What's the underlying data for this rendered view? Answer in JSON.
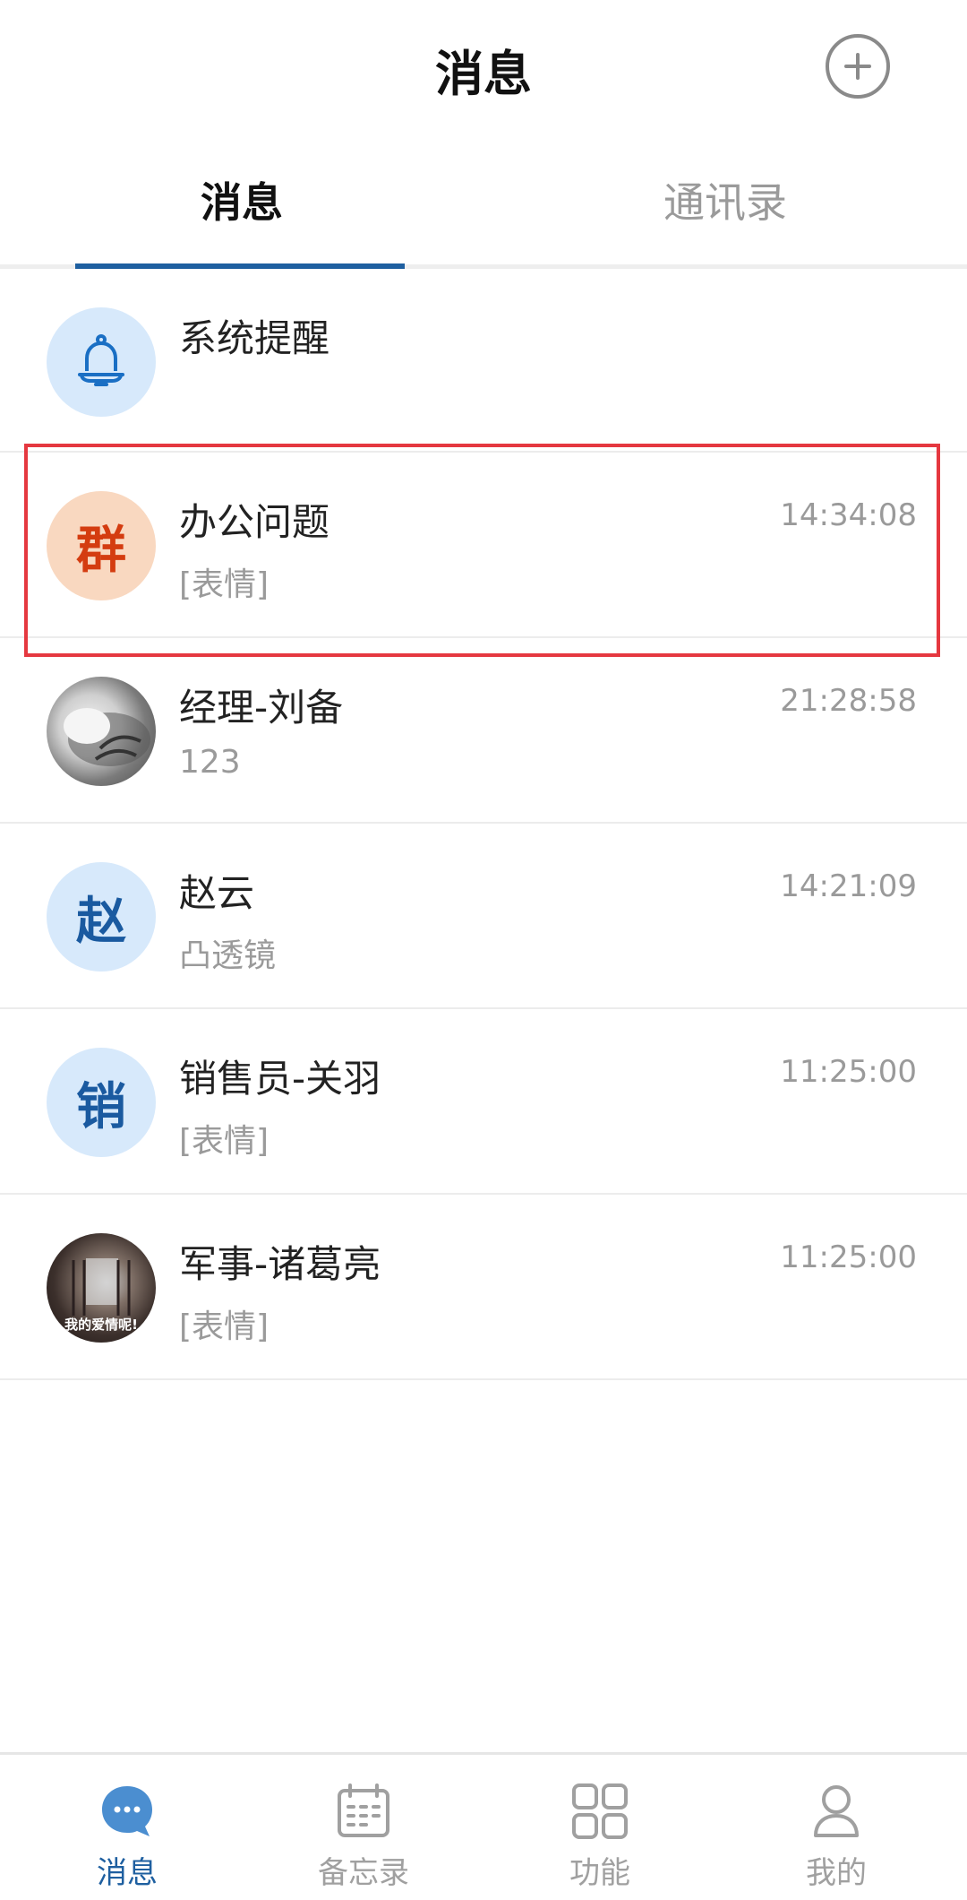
{
  "header": {
    "title": "消息"
  },
  "tabs": [
    {
      "label": "消息",
      "active": true
    },
    {
      "label": "通讯录",
      "active": false
    }
  ],
  "conversations": [
    {
      "name": "系统提醒",
      "avatar_icon": "bell-icon",
      "preview": "",
      "time": ""
    },
    {
      "name": "办公问题",
      "avatar_text": "群",
      "preview": "[表情]",
      "time": "14:34:08",
      "highlighted": true
    },
    {
      "name": "经理-刘备",
      "avatar_icon": "cat-photo",
      "preview": "123",
      "time": "21:28:58"
    },
    {
      "name": "赵云",
      "avatar_text": "赵",
      "preview": "凸透镜",
      "time": "14:21:09"
    },
    {
      "name": "销售员-关羽",
      "avatar_text": "销",
      "preview": "[表情]",
      "time": "11:25:00"
    },
    {
      "name": "军事-诸葛亮",
      "avatar_icon": "photo",
      "avatar_caption": "我的爱情呢!",
      "preview": "[表情]",
      "time": "11:25:00"
    }
  ],
  "bottom_nav": [
    {
      "label": "消息",
      "icon": "chat-bubble-icon",
      "active": true
    },
    {
      "label": "备忘录",
      "icon": "calendar-icon",
      "active": false
    },
    {
      "label": "功能",
      "icon": "grid-icon",
      "active": false
    },
    {
      "label": "我的",
      "icon": "person-icon",
      "active": false
    }
  ],
  "colors": {
    "accent": "#1e5fa0",
    "highlight": "#e53840",
    "group_avatar": "#d43c10"
  }
}
